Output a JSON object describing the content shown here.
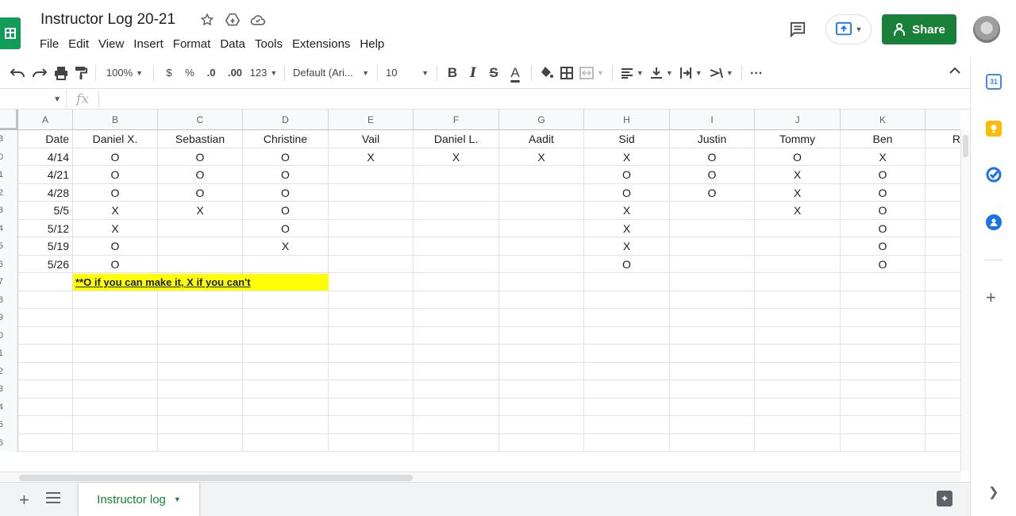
{
  "header": {
    "title": "Instructor Log 20-21",
    "menu": [
      "File",
      "Edit",
      "View",
      "Insert",
      "Format",
      "Data",
      "Tools",
      "Extensions",
      "Help"
    ],
    "share_label": "Share"
  },
  "toolbar": {
    "zoom": "100%",
    "currency": "$",
    "percent": "%",
    "decimal_decrease": ".0",
    "decimal_increase": ".00",
    "more_formats": "123",
    "font": "Default (Ari...",
    "font_size": "10",
    "bold": "B",
    "italic": "I",
    "strikethrough": "S",
    "text_color": "A",
    "more": "⋯"
  },
  "formula_bar": {
    "fx": "fx"
  },
  "grid": {
    "columns": [
      "A",
      "B",
      "C",
      "D",
      "E",
      "F",
      "G",
      "H",
      "I",
      "J",
      "K"
    ],
    "row_numbers": [
      "3",
      "0",
      "1",
      "2",
      "3",
      "4",
      "5",
      "6",
      "7",
      "8",
      "9",
      "0",
      "1",
      "2",
      "3",
      "4",
      "5",
      "6"
    ],
    "header_row": [
      "Date",
      "Daniel X.",
      "Sebastian",
      "Christine",
      "Vail",
      "Daniel L.",
      "Aadit",
      "Sid",
      "Justin",
      "Tommy",
      "Ben",
      "R"
    ],
    "data_rows": [
      [
        "4/14",
        "O",
        "O",
        "O",
        "X",
        "X",
        "X",
        "X",
        "O",
        "O",
        "X"
      ],
      [
        "4/21",
        "O",
        "O",
        "O",
        "",
        "",
        "",
        "O",
        "O",
        "X",
        "O"
      ],
      [
        "4/28",
        "O",
        "O",
        "O",
        "",
        "",
        "",
        "O",
        "O",
        "X",
        "O"
      ],
      [
        "5/5",
        "X",
        "X",
        "O",
        "",
        "",
        "",
        "X",
        "",
        "X",
        "O"
      ],
      [
        "5/12",
        "X",
        "",
        "O",
        "",
        "",
        "",
        "X",
        "",
        "",
        "O"
      ],
      [
        "5/19",
        "O",
        "",
        "X",
        "",
        "",
        "",
        "X",
        "",
        "",
        "O"
      ],
      [
        "5/26",
        "O",
        "",
        "",
        "",
        "",
        "",
        "O",
        "",
        "",
        "O"
      ]
    ],
    "note": "**O if you can make it, X if you can't",
    "note_color": "#ffff00"
  },
  "sheets": {
    "active_tab": "Instructor log"
  },
  "side_panel": {
    "calendar_day": "31",
    "calendar_color": "#4285f4",
    "keep_color": "#fbbc04",
    "tasks_color": "#1a73e8",
    "contacts_color": "#1a73e8"
  },
  "colors": {
    "brand_green": "#188038",
    "sheets_green": "#0f9d58"
  }
}
